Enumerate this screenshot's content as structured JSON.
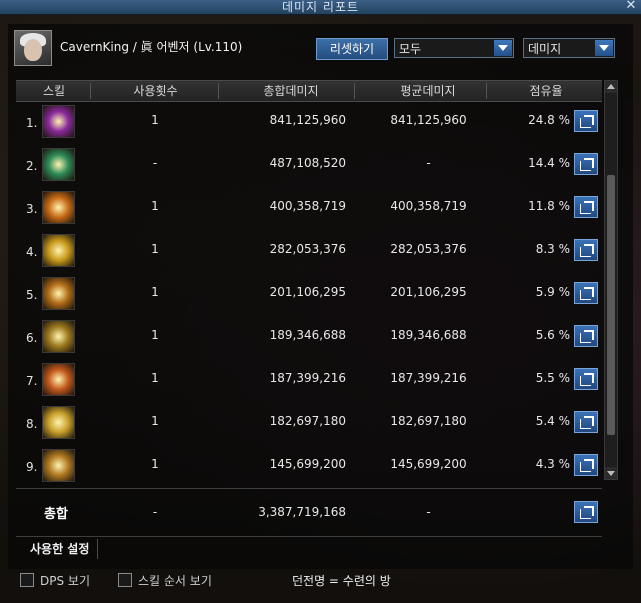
{
  "window": {
    "title": "데미지 리포트",
    "close_icon": "close-icon"
  },
  "header": {
    "character": "CavernKing / 眞 어벤저 (Lv.110)",
    "reset_label": "리셋하기",
    "filter_value": "모두",
    "metric_value": "데미지"
  },
  "columns": [
    "스킬",
    "사용횟수",
    "총합데미지",
    "평균데미지",
    "점유율"
  ],
  "rows": [
    {
      "index": "1.",
      "count": "1",
      "total": "841,125,960",
      "avg": "841,125,960",
      "share": "24.8 %",
      "icon": "skill-icon-1",
      "color": "#8a2b9c"
    },
    {
      "index": "2.",
      "count": "-",
      "total": "487,108,520",
      "avg": "-",
      "share": "14.4 %",
      "icon": "skill-icon-2",
      "color": "#2e8b57"
    },
    {
      "index": "3.",
      "count": "1",
      "total": "400,358,719",
      "avg": "400,358,719",
      "share": "11.8 %",
      "icon": "skill-icon-3",
      "color": "#c86b16"
    },
    {
      "index": "4.",
      "count": "1",
      "total": "282,053,376",
      "avg": "282,053,376",
      "share": "8.3 %",
      "icon": "skill-icon-4",
      "color": "#c99a1c"
    },
    {
      "index": "5.",
      "count": "1",
      "total": "201,106,295",
      "avg": "201,106,295",
      "share": "5.9 %",
      "icon": "skill-icon-5",
      "color": "#b26d17"
    },
    {
      "index": "6.",
      "count": "1",
      "total": "189,346,688",
      "avg": "189,346,688",
      "share": "5.6 %",
      "icon": "skill-icon-6",
      "color": "#9c7a1f"
    },
    {
      "index": "7.",
      "count": "1",
      "total": "187,399,216",
      "avg": "187,399,216",
      "share": "5.5 %",
      "icon": "skill-icon-7",
      "color": "#c45a1d"
    },
    {
      "index": "8.",
      "count": "1",
      "total": "182,697,180",
      "avg": "182,697,180",
      "share": "5.4 %",
      "icon": "skill-icon-8",
      "color": "#c9a02a"
    },
    {
      "index": "9.",
      "count": "1",
      "total": "145,699,200",
      "avg": "145,699,200",
      "share": "4.3 %",
      "icon": "skill-icon-9",
      "color": "#b07a22"
    }
  ],
  "totals": {
    "label": "총합",
    "count": "-",
    "total": "3,387,719,168",
    "avg": "-"
  },
  "settings_tab": "사용한 설정",
  "footer": {
    "dps_label": "DPS 보기",
    "order_label": "스킬 순서 보기",
    "dungeon": "던전명 = 수련의 방"
  }
}
